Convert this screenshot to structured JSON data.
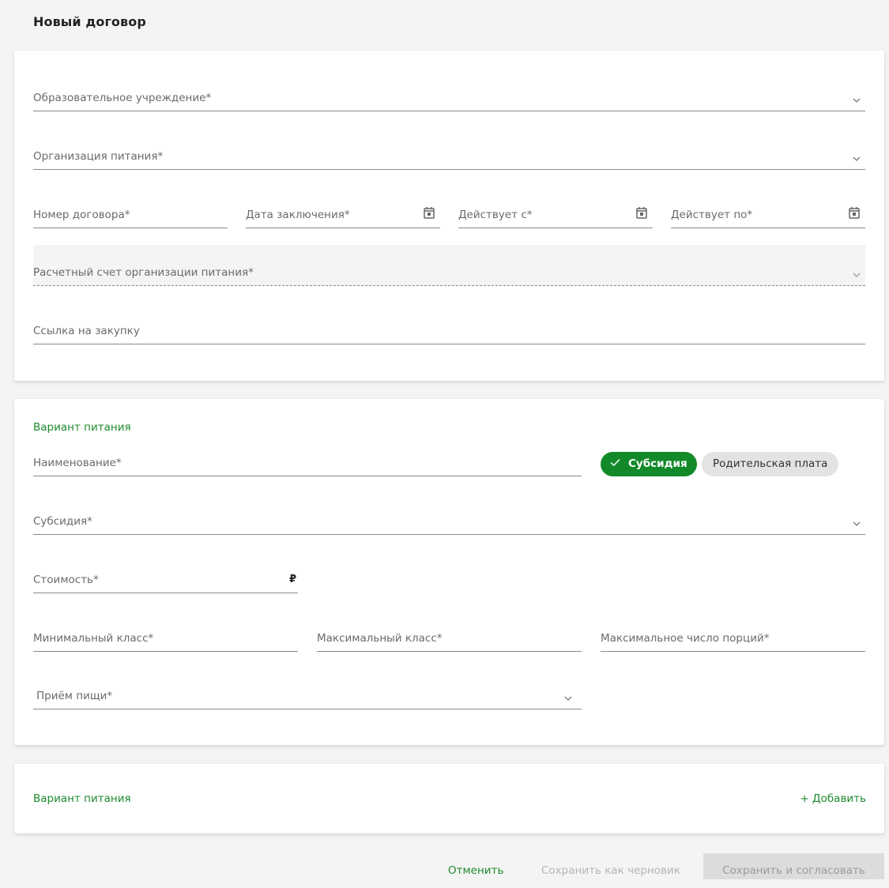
{
  "page": {
    "title": "Новый договор"
  },
  "contract": {
    "institution_label": "Образовательное учреждение*",
    "catering_org_label": "Организация питания*",
    "contract_number_label": "Номер договора*",
    "conclusion_date_label": "Дата заключения*",
    "valid_from_label": "Действует с*",
    "valid_to_label": "Действует по*",
    "account_label": "Расчетный счет организации питания*",
    "purchase_link_label": "Ссылка на закупку"
  },
  "meal_variant": {
    "section_title": "Вариант питания",
    "name_label": "Наименование*",
    "chip_subsidy": "Субсидия",
    "chip_parent_fee": "Родительская плата",
    "subsidy_label": "Субсидия*",
    "cost_label": "Стоимость*",
    "currency": "₽",
    "min_class_label": "Минимальный класс*",
    "max_class_label": "Максимальный класс*",
    "max_portions_label": "Максимальное число порций*",
    "meal_label": "Приём пищи*"
  },
  "meal_variant_add": {
    "section_title": "Вариант питания",
    "add_label": "+ Добавить"
  },
  "footer": {
    "cancel_label": "Отменить",
    "save_draft_label": "Сохранить как черновик",
    "save_approve_label": "Сохранить и согласовать"
  },
  "colors": {
    "accent": "#138a2a",
    "accent_text": "#1e8a2e",
    "chip_inactive": "#e3e3e3",
    "disabled_button": "#dcdcdc"
  },
  "icons": {
    "dropdown": "chevron-down-icon",
    "date": "calendar-icon",
    "selected": "check-icon"
  }
}
